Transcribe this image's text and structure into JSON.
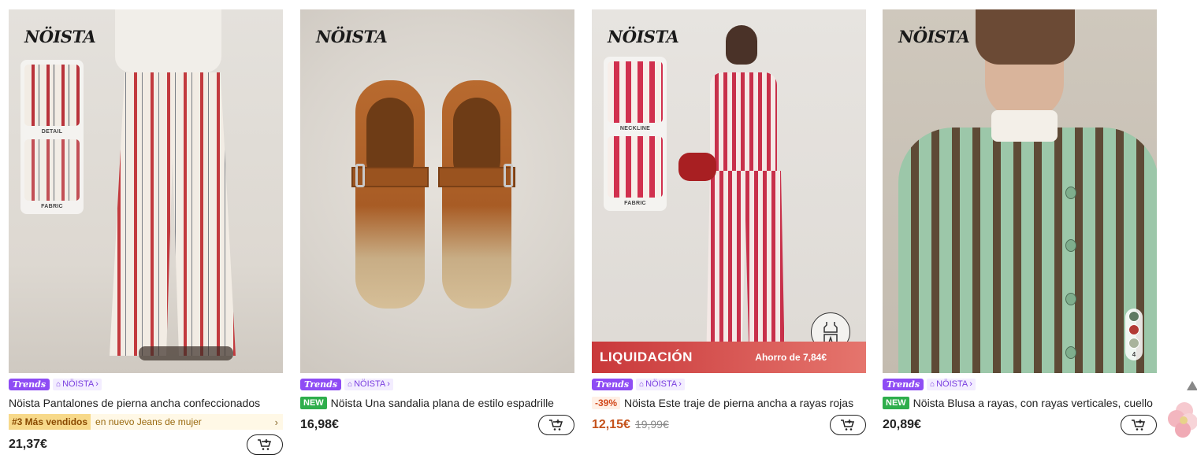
{
  "products": [
    {
      "brand_logo": "NÖISTA",
      "inset_captions": [
        "DETAIL",
        "FABRIC"
      ],
      "trends_label": "Trends",
      "store_label": "NÖISTA",
      "title": "Nöista Pantalones de pierna ancha confeccionados",
      "ranking": {
        "badge": "#3 Más vendidos",
        "text": "en nuevo Jeans de mujer",
        "chevron": "›"
      },
      "price": "21,37€"
    },
    {
      "brand_logo": "NÖISTA",
      "trends_label": "Trends",
      "store_label": "NÖISTA",
      "badge": "NEW",
      "title": "Nöista Una sandalia plana de estilo espadrille",
      "price": "16,98€"
    },
    {
      "brand_logo": "NÖISTA",
      "inset_captions": [
        "NECKLINE",
        "FABRIC"
      ],
      "clearance_label": "LIQUIDACIÓN",
      "savings_label": "Ahorro de 7,84€",
      "trends_label": "Trends",
      "store_label": "NÖISTA",
      "badge": "-39%",
      "title": "Nöista Este traje de pierna ancha a rayas rojas",
      "price": "12,15€",
      "original_price": "19,99€"
    },
    {
      "brand_logo": "NÖISTA",
      "swatches": [
        "#5f7a62",
        "#b23a35",
        "#a9b39c"
      ],
      "swatch_count": "4",
      "trends_label": "Trends",
      "store_label": "NÖISTA",
      "badge": "NEW",
      "title": "Nöista Blusa a rayas, con rayas verticales, cuello",
      "price": "20,89€"
    }
  ],
  "colors": {
    "trends": "#8e4cf4",
    "new_badge": "#2fae4c",
    "sale_price": "#c5521b",
    "clearance": "#c9383a"
  },
  "icons": {
    "store": "store-icon",
    "cart": "add-to-cart-icon",
    "chevron": "chevron-right-icon"
  }
}
